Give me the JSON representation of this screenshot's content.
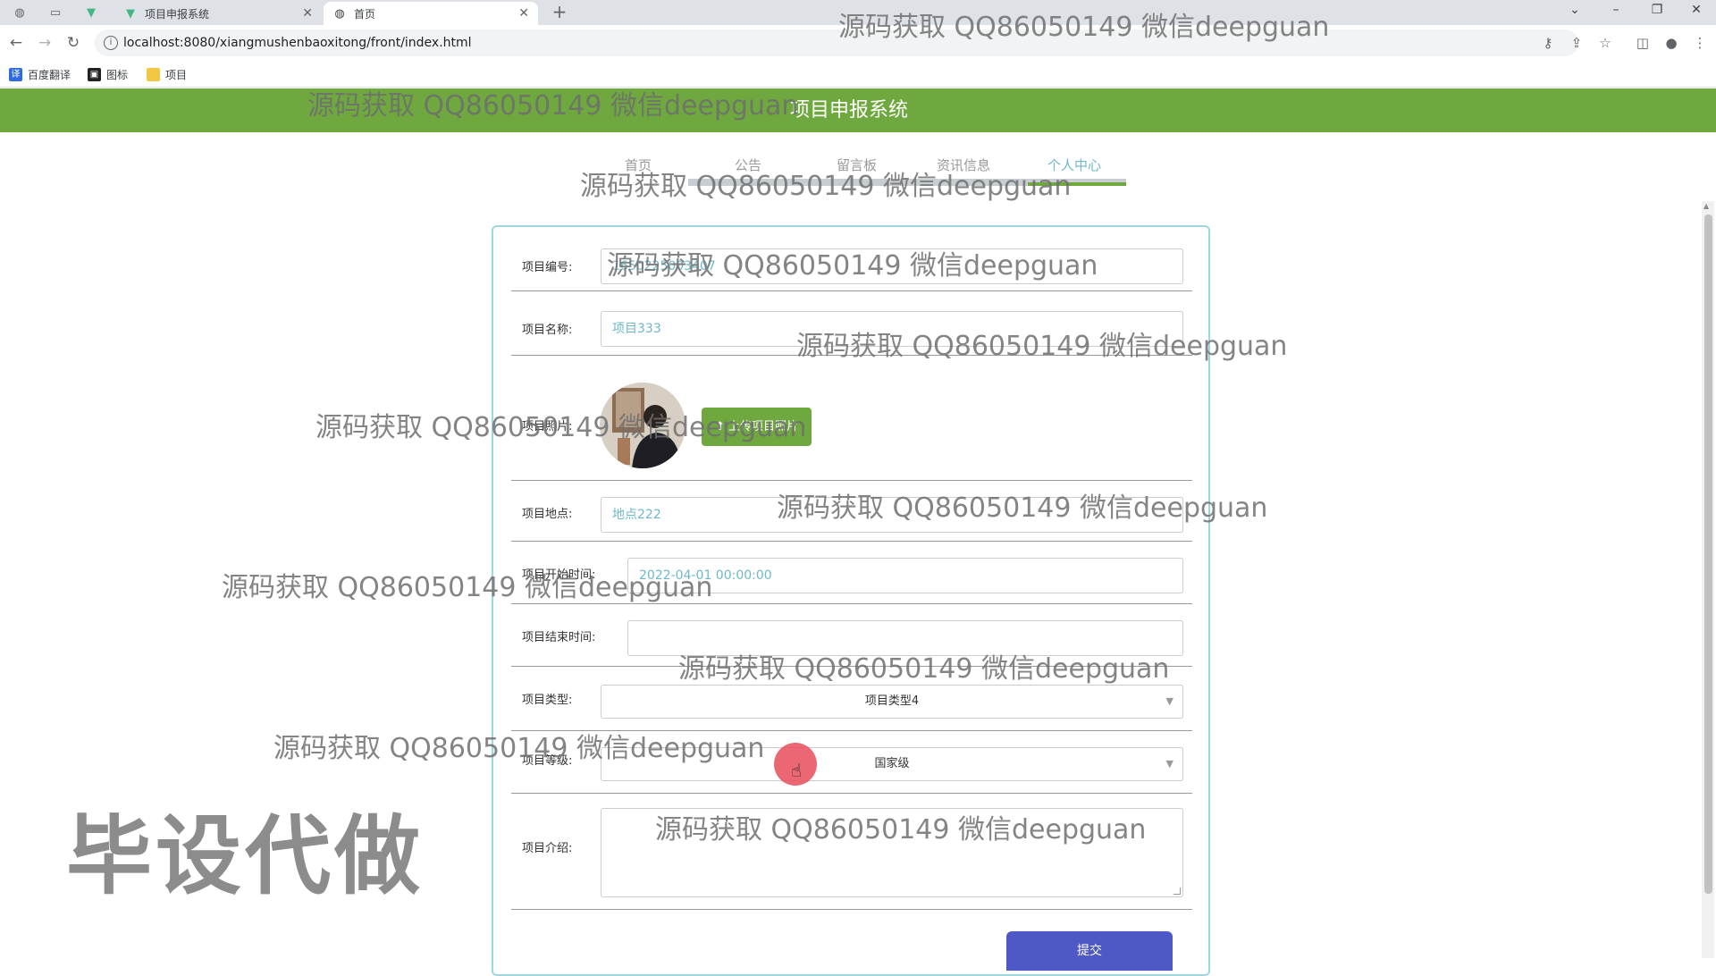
{
  "browser": {
    "tabs": [
      {
        "label": "项目申报系统",
        "icon": "vue-icon"
      },
      {
        "label": "首页",
        "icon": "globe-icon"
      }
    ],
    "url": "localhost:8080/xiangmushenbaoxitong/front/index.html",
    "bookmarks": [
      {
        "label": "百度翻译"
      },
      {
        "label": "图标"
      },
      {
        "label": "项目"
      }
    ]
  },
  "site": {
    "title": "项目申报系统",
    "nav": [
      {
        "label": "首页"
      },
      {
        "label": "公告"
      },
      {
        "label": "留言板"
      },
      {
        "label": "资讯信息"
      },
      {
        "label": "个人中心"
      }
    ],
    "active_nav": "个人中心"
  },
  "form": {
    "fields": {
      "number": {
        "label": "项目编号:",
        "value": "1650225003407"
      },
      "name": {
        "label": "项目名称:",
        "value": "项目333"
      },
      "photo": {
        "label": "项目照片:",
        "upload_label": "上传项目照片"
      },
      "location": {
        "label": "项目地点:",
        "value": "地点222"
      },
      "start_time": {
        "label": "项目开始时间:",
        "value": "2022-04-01 00:00:00"
      },
      "end_time": {
        "label": "项目结束时间:",
        "value": ""
      },
      "type": {
        "label": "项目类型:",
        "value": "项目类型4"
      },
      "level": {
        "label": "项目等级:",
        "value": "国家级"
      },
      "intro": {
        "label": "项目介绍:",
        "value": ""
      }
    },
    "submit_label": "提交"
  },
  "watermarks": {
    "line": "源码获取 QQ86050149 微信deepguan",
    "big": "毕设代做"
  },
  "colors": {
    "header_green": "#6fa83e",
    "card_border": "#9fd7e0",
    "submit_blue": "#4f58c7",
    "input_text": "#6fb8c8"
  }
}
